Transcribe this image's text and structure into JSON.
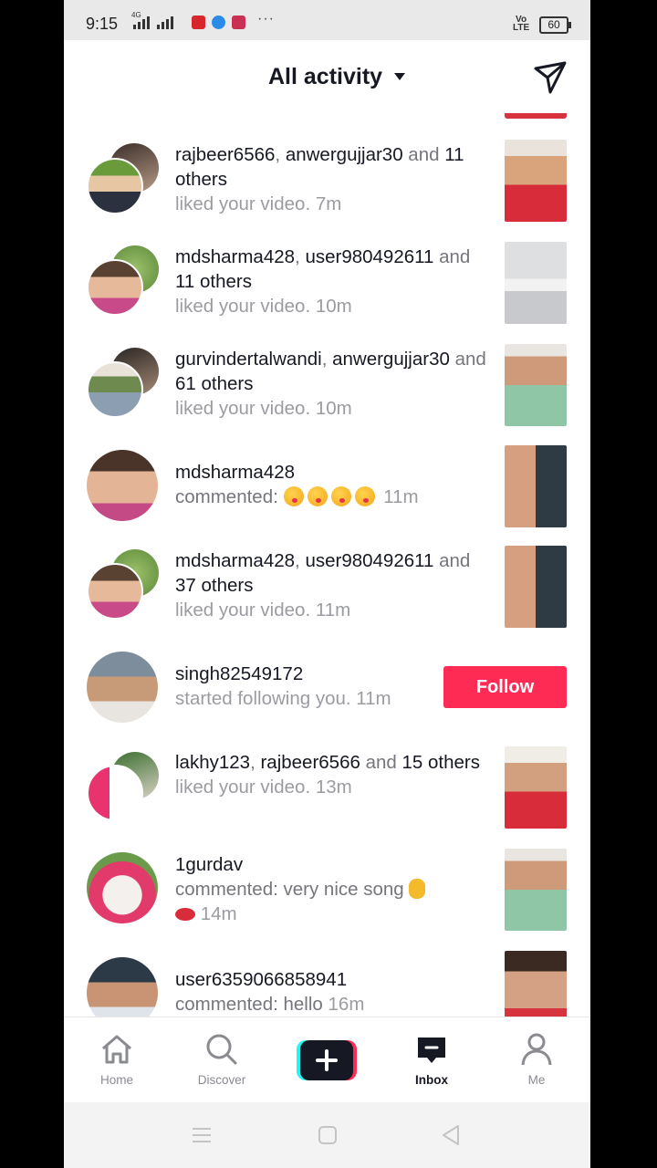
{
  "status_bar": {
    "time": "9:15",
    "network": "4G",
    "volte": [
      "Vo",
      "LTE"
    ],
    "battery": "60"
  },
  "header": {
    "title": "All activity"
  },
  "notifications": [
    {
      "users": "rajbeer6566",
      "sep": ", ",
      "users2": "anwergujjar30",
      "mid": " and ",
      "count": "11",
      "tail": " others",
      "action": "liked your video.",
      "time": "7m"
    },
    {
      "users": "mdsharma428",
      "sep": ", ",
      "users2": "user980492611",
      "mid": " and ",
      "count": "11",
      "tail": " others",
      "action": "liked your video.",
      "time": "10m"
    },
    {
      "users": "gurvindertalwandi",
      "sep": ", ",
      "users2": "anwergujjar30",
      "mid": " and ",
      "count": "61",
      "tail": " others",
      "action": "liked your video.",
      "time": "10m"
    },
    {
      "users": "mdsharma428",
      "action": "commented:",
      "time": "11m"
    },
    {
      "users": "mdsharma428",
      "sep": ", ",
      "users2": "user980492611",
      "mid": " and ",
      "count": "37",
      "tail": " others",
      "action": "liked your video.",
      "time": "11m"
    },
    {
      "users": "singh82549172",
      "action": "started following you.",
      "time": "11m",
      "button": "Follow"
    },
    {
      "users": "lakhy123",
      "sep": ", ",
      "users2": "rajbeer6566",
      "mid": " and ",
      "count": "15",
      "tail": " others",
      "action": "liked your video.",
      "time": "13m"
    },
    {
      "users": "1gurdav",
      "action": "commented: very nice song",
      "time": "14m"
    },
    {
      "users": "user6359066858941",
      "action": "commented: hello",
      "time": "16m"
    }
  ],
  "tabs": [
    {
      "label": "Home"
    },
    {
      "label": "Discover"
    },
    {
      "label": "Inbox"
    },
    {
      "label": "Me"
    }
  ],
  "icons": {
    "home": "home-icon",
    "discover": "search-icon",
    "inbox": "inbox-icon",
    "me": "profile-icon",
    "create": "plus-icon",
    "direct": "paper-plane-icon"
  },
  "colors": {
    "accent": "#fe2c55",
    "tab_active": "#161823",
    "tab_inactive": "#8a8b91"
  }
}
